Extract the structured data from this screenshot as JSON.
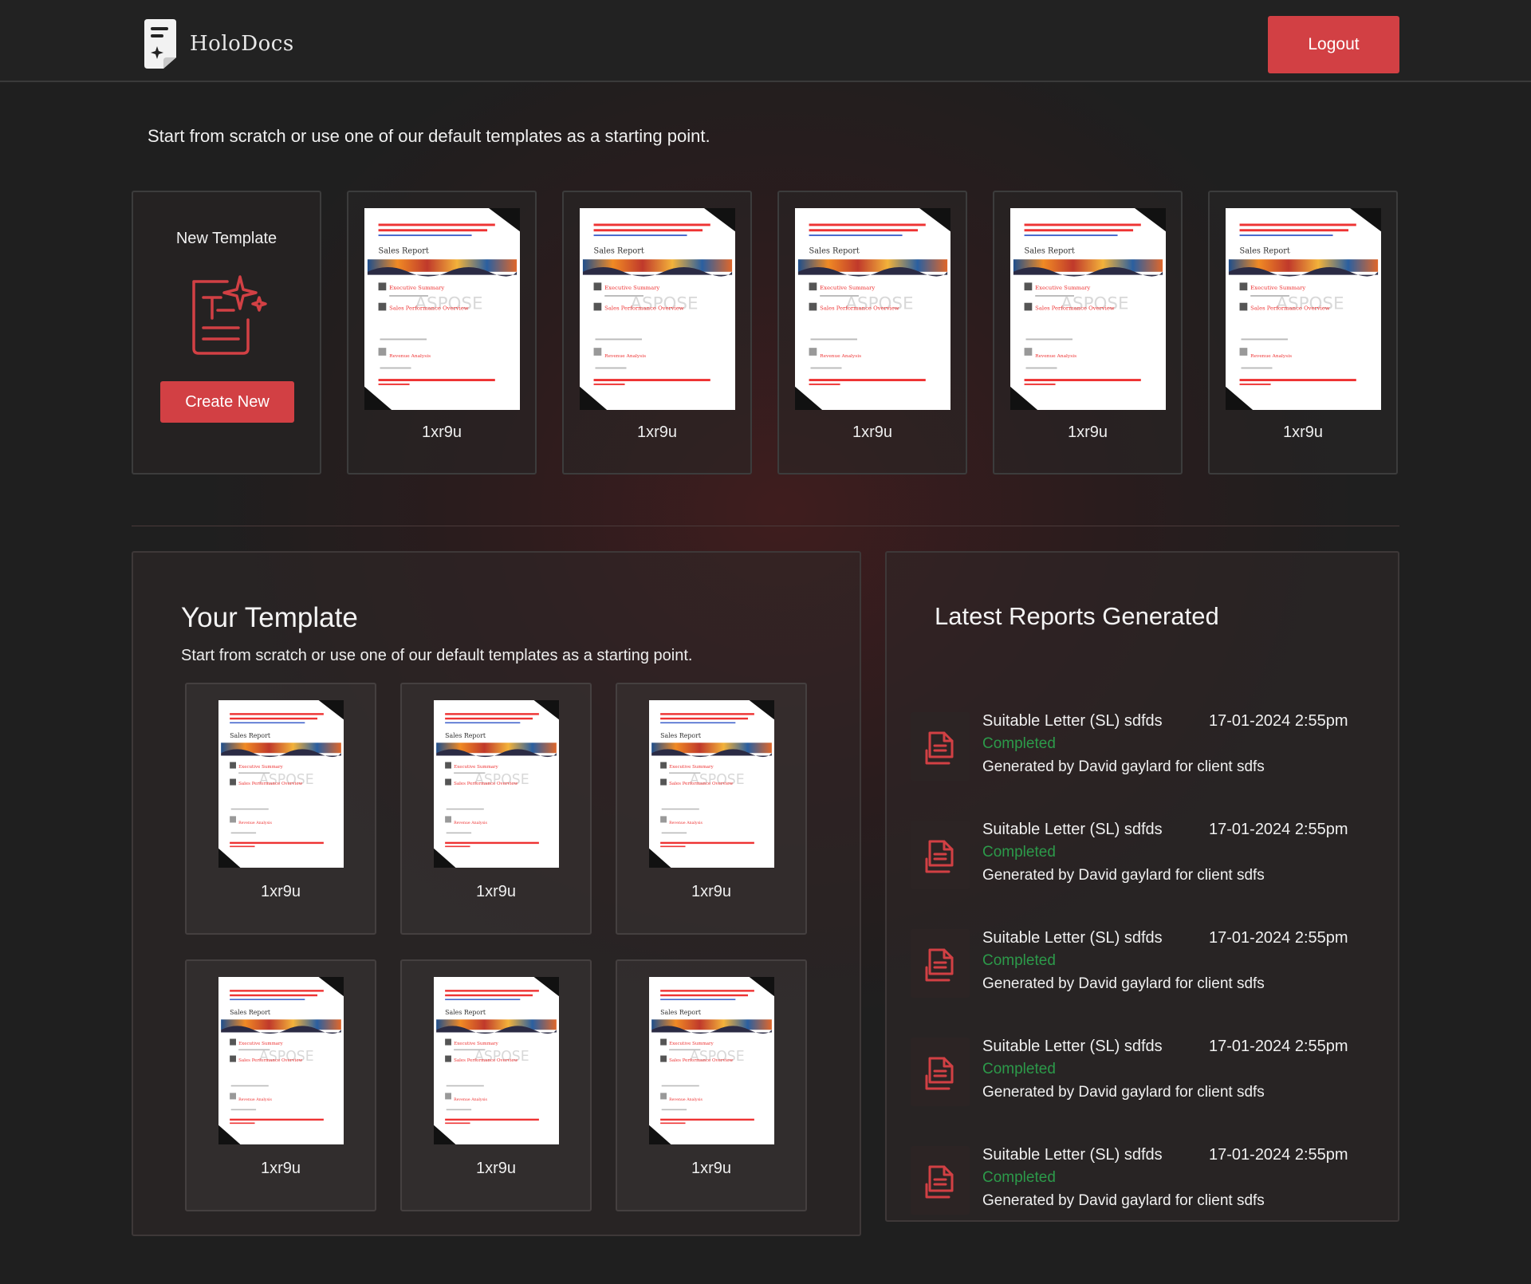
{
  "header": {
    "brand": "HoloDocs",
    "logout_label": "Logout"
  },
  "intro_text": "Start from scratch or use one of our default templates as a starting point.",
  "new_template": {
    "title": "New Template",
    "button_label": "Create New"
  },
  "default_templates": [
    {
      "name": "1xr9u"
    },
    {
      "name": "1xr9u"
    },
    {
      "name": "1xr9u"
    },
    {
      "name": "1xr9u"
    },
    {
      "name": "1xr9u"
    }
  ],
  "template_preview": {
    "heading": "Sales Report",
    "watermark": "ASPOSE",
    "section_1": "Executive Summary",
    "section_2": "Sales Performance Overview",
    "section_3": "Revenue Analysis"
  },
  "your_template": {
    "title": "Your Template",
    "subtitle": "Start from scratch or use one of our default templates as a starting point.",
    "items": [
      {
        "name": "1xr9u"
      },
      {
        "name": "1xr9u"
      },
      {
        "name": "1xr9u"
      },
      {
        "name": "1xr9u"
      },
      {
        "name": "1xr9u"
      },
      {
        "name": "1xr9u"
      }
    ]
  },
  "latest_reports": {
    "title": "Latest Reports Generated",
    "items": [
      {
        "name": "Suitable Letter (SL) sdfds",
        "date": "17-01-2024 2:55pm",
        "status": "Completed",
        "by": "Generated by David gaylard for client sdfs"
      },
      {
        "name": "Suitable Letter (SL) sdfds",
        "date": "17-01-2024 2:55pm",
        "status": "Completed",
        "by": "Generated by David gaylard for client sdfs"
      },
      {
        "name": "Suitable Letter (SL) sdfds",
        "date": "17-01-2024 2:55pm",
        "status": "Completed",
        "by": "Generated by David gaylard for client sdfs"
      },
      {
        "name": "Suitable Letter (SL) sdfds",
        "date": "17-01-2024 2:55pm",
        "status": "Completed",
        "by": "Generated by David gaylard for client sdfs"
      },
      {
        "name": "Suitable Letter (SL) sdfds",
        "date": "17-01-2024 2:55pm",
        "status": "Completed",
        "by": "Generated by David gaylard for client sdfs"
      }
    ]
  },
  "colors": {
    "accent": "#d24044",
    "status_completed": "#2c9a4a",
    "background": "#1f1f1f"
  }
}
